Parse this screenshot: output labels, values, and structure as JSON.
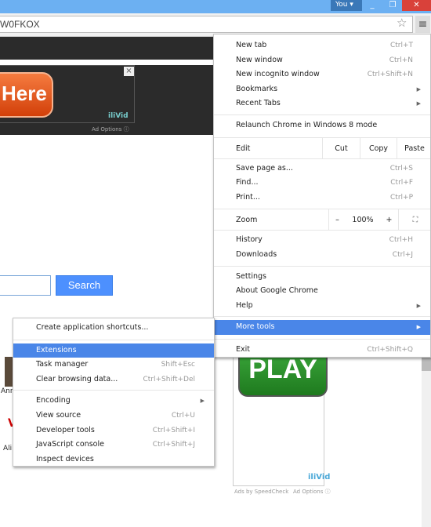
{
  "window": {
    "profile": "You",
    "minimize": "_",
    "restore": "❐",
    "close": "✕"
  },
  "toolbar": {
    "url": "W0FKOX",
    "star_icon": "star-icon",
    "menu_icon": "hamburger-icon"
  },
  "page": {
    "ad_button": "Here",
    "ad_close": "×",
    "ad_logo": "iliVid",
    "ad_options": "Ad Options",
    "search_button": "Search",
    "thumb1_caption": "Ann",
    "thumb2_caption": "Ali",
    "play_button": "PLAY",
    "ad2_logo": "iliVid",
    "ads_by": "Ads by SpeedCheck",
    "ad2_options": "Ad Options"
  },
  "main_menu": {
    "new_tab": {
      "label": "New tab",
      "shortcut": "Ctrl+T"
    },
    "new_window": {
      "label": "New window",
      "shortcut": "Ctrl+N"
    },
    "incognito": {
      "label": "New incognito window",
      "shortcut": "Ctrl+Shift+N"
    },
    "bookmarks": {
      "label": "Bookmarks"
    },
    "recent_tabs": {
      "label": "Recent Tabs"
    },
    "relaunch": {
      "label": "Relaunch Chrome in Windows 8 mode"
    },
    "edit": {
      "label": "Edit",
      "cut": "Cut",
      "copy": "Copy",
      "paste": "Paste"
    },
    "save_page": {
      "label": "Save page as...",
      "shortcut": "Ctrl+S"
    },
    "find": {
      "label": "Find...",
      "shortcut": "Ctrl+F"
    },
    "print": {
      "label": "Print...",
      "shortcut": "Ctrl+P"
    },
    "zoom": {
      "label": "Zoom",
      "minus": "–",
      "value": "100%",
      "plus": "+",
      "fullscreen": "⛶"
    },
    "history": {
      "label": "History",
      "shortcut": "Ctrl+H"
    },
    "downloads": {
      "label": "Downloads",
      "shortcut": "Ctrl+J"
    },
    "settings": {
      "label": "Settings"
    },
    "about": {
      "label": "About Google Chrome"
    },
    "help": {
      "label": "Help"
    },
    "more_tools": {
      "label": "More tools"
    },
    "exit": {
      "label": "Exit",
      "shortcut": "Ctrl+Shift+Q"
    }
  },
  "sub_menu": {
    "create_shortcuts": {
      "label": "Create application shortcuts..."
    },
    "extensions": {
      "label": "Extensions"
    },
    "task_manager": {
      "label": "Task manager",
      "shortcut": "Shift+Esc"
    },
    "clear_data": {
      "label": "Clear browsing data...",
      "shortcut": "Ctrl+Shift+Del"
    },
    "encoding": {
      "label": "Encoding"
    },
    "view_source": {
      "label": "View source",
      "shortcut": "Ctrl+U"
    },
    "dev_tools": {
      "label": "Developer tools",
      "shortcut": "Ctrl+Shift+I"
    },
    "js_console": {
      "label": "JavaScript console",
      "shortcut": "Ctrl+Shift+J"
    },
    "inspect_devices": {
      "label": "Inspect devices"
    }
  },
  "colors": {
    "highlight": "#4a86e8",
    "titlebar": "#6cb0f2",
    "search_button": "#4d90fe",
    "play": "#2a962a"
  }
}
